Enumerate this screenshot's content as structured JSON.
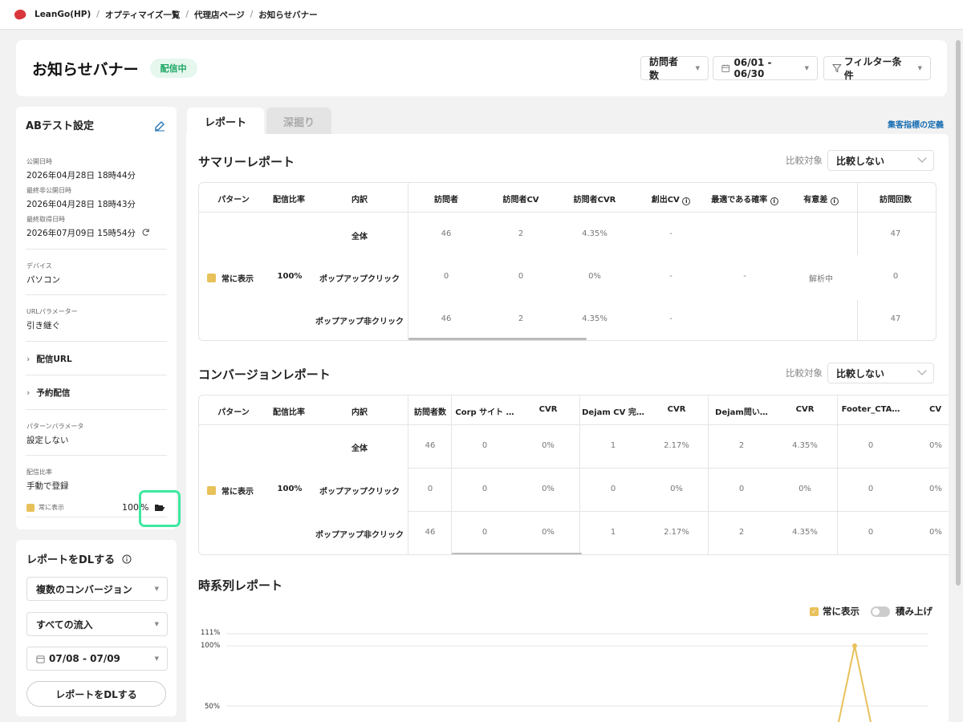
{
  "breadcrumb": [
    "LeanGo(HP)",
    "オプティマイズ一覧",
    "代理店ページ",
    "お知らせバナー"
  ],
  "header": {
    "title": "お知らせバナー",
    "status": "配信中",
    "metric_select": "訪問者数",
    "date_range": "06/01 - 06/30",
    "filter_label": "フィルター条件"
  },
  "ab_settings": {
    "title": "ABテスト設定",
    "published_label": "公開日時",
    "published_value": "2026年04月28日 18時44分",
    "unpublished_label": "最終非公開日時",
    "unpublished_value": "2026年04月28日 18時43分",
    "fetched_label": "最終取得日時",
    "fetched_value": "2026年07月09日 15時54分",
    "device_label": "デバイス",
    "device_value": "パソコン",
    "urlparam_label": "URLパラメーター",
    "urlparam_value": "引き継ぐ",
    "delivery_url": "配信URL",
    "scheduled": "予約配信",
    "pattern_param_label": "パターンパラメータ",
    "pattern_param_value": "設定しない",
    "ratio_label": "配信比率",
    "ratio_value": "手動で登録",
    "pattern_name": "常に表示",
    "pattern_ratio": "100",
    "pattern_unit": "%"
  },
  "download": {
    "title": "レポートをDLする",
    "conversion_select": "複数のコンバージョン",
    "flow_select": "すべての流入",
    "date_range": "07/08 - 07/09",
    "button": "レポートをDLする"
  },
  "tabs": [
    "レポート",
    "深掘り"
  ],
  "metric_link": "集客指標の定義",
  "summary": {
    "title": "サマリーレポート",
    "compare_label": "比較対象",
    "compare_value": "比較しない",
    "headers": [
      "パターン",
      "配信比率",
      "内訳",
      "訪問者",
      "訪問者CV",
      "訪問者CVR",
      "創出CV",
      "最適である確率",
      "有意差",
      "訪問回数"
    ],
    "pattern": "常に表示",
    "ratio": "100%",
    "rows": [
      {
        "breakdown": "全体",
        "visitors": "46",
        "cv": "2",
        "cvr": "4.35%",
        "created_cv": "-",
        "visits": "47"
      },
      {
        "breakdown": "ポップアップクリック",
        "visitors": "0",
        "cv": "0",
        "cvr": "0%",
        "created_cv": "-",
        "visits": "0"
      },
      {
        "breakdown": "ポップアップ非クリック",
        "visitors": "46",
        "cv": "2",
        "cvr": "4.35%",
        "created_cv": "-",
        "visits": "47"
      }
    ],
    "best_prob": "-",
    "significance": "解析中"
  },
  "conversion": {
    "title": "コンバージョンレポート",
    "compare_label": "比較対象",
    "compare_value": "比較しない",
    "headers": [
      "パターン",
      "配信比率",
      "内訳",
      "訪問者数",
      "Corp サイト …",
      "CVR",
      "Dejam CV 完…",
      "CVR",
      "Dejam問い…",
      "CVR",
      "Footer_CTA…",
      "CV"
    ],
    "pattern": "常に表示",
    "ratio": "100%",
    "rows": [
      {
        "breakdown": "全体",
        "cells": [
          "46",
          "0",
          "0%",
          "1",
          "2.17%",
          "2",
          "4.35%",
          "0",
          "0%"
        ]
      },
      {
        "breakdown": "ポップアップクリック",
        "cells": [
          "0",
          "0",
          "0%",
          "0",
          "0%",
          "0",
          "0%",
          "0",
          "0%"
        ]
      },
      {
        "breakdown": "ポップアップ非クリック",
        "cells": [
          "46",
          "0",
          "0%",
          "1",
          "2.17%",
          "2",
          "4.35%",
          "0",
          "0%"
        ]
      }
    ]
  },
  "timeseries": {
    "title": "時系列レポート",
    "legend_label": "常に表示",
    "stack_label": "積み上げ",
    "y_ticks": [
      "111%",
      "100%",
      "50%"
    ]
  },
  "colors": {
    "accent_green": "#1aa663",
    "pattern_yellow": "#e8c15a",
    "highlight": "#3ee8a0",
    "link_blue": "#1a6fb3"
  }
}
